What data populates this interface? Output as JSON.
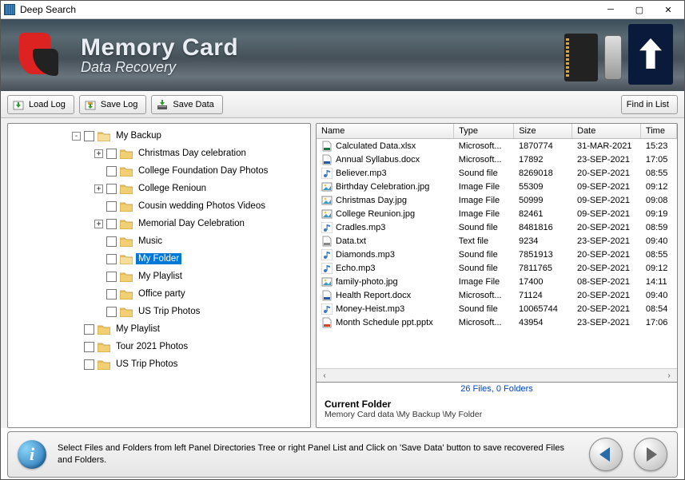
{
  "window": {
    "title": "Deep Search"
  },
  "banner": {
    "title": "Memory Card",
    "subtitle": "Data Recovery"
  },
  "toolbar": {
    "load_log": "Load Log",
    "save_log": "Save Log",
    "save_data": "Save Data",
    "find_in_list": "Find in List"
  },
  "tree": {
    "root_label": "My Backup",
    "selected": "My Folder",
    "items": [
      {
        "label": "Christmas Day celebration",
        "expandable": true
      },
      {
        "label": "College Foundation Day Photos",
        "expandable": false
      },
      {
        "label": "College Renioun",
        "expandable": true
      },
      {
        "label": "Cousin wedding Photos Videos",
        "expandable": false
      },
      {
        "label": "Memorial Day Celebration",
        "expandable": true
      },
      {
        "label": "Music",
        "expandable": false
      },
      {
        "label": "My Folder",
        "expandable": false,
        "selected": true
      },
      {
        "label": "My Playlist",
        "expandable": false
      },
      {
        "label": "Office party",
        "expandable": false
      },
      {
        "label": "US Trip Photos",
        "expandable": false
      }
    ],
    "siblings": [
      {
        "label": "My Playlist"
      },
      {
        "label": "Tour 2021 Photos"
      },
      {
        "label": "US Trip Photos"
      }
    ]
  },
  "file_columns": {
    "name": "Name",
    "type": "Type",
    "size": "Size",
    "date": "Date",
    "time": "Time"
  },
  "files": [
    {
      "name": "Calculated Data.xlsx",
      "type": "Microsoft...",
      "size": "1870774",
      "date": "31-MAR-2021",
      "time": "15:23",
      "icon": "xlsx"
    },
    {
      "name": "Annual Syllabus.docx",
      "type": "Microsoft...",
      "size": "17892",
      "date": "23-SEP-2021",
      "time": "17:05",
      "icon": "docx"
    },
    {
      "name": "Believer.mp3",
      "type": "Sound file",
      "size": "8269018",
      "date": "20-SEP-2021",
      "time": "08:55",
      "icon": "snd"
    },
    {
      "name": "Birthday Celebration.jpg",
      "type": "Image File",
      "size": "55309",
      "date": "09-SEP-2021",
      "time": "09:12",
      "icon": "img"
    },
    {
      "name": "Christmas Day.jpg",
      "type": "Image File",
      "size": "50999",
      "date": "09-SEP-2021",
      "time": "09:08",
      "icon": "img"
    },
    {
      "name": "College Reunion.jpg",
      "type": "Image File",
      "size": "82461",
      "date": "09-SEP-2021",
      "time": "09:19",
      "icon": "img"
    },
    {
      "name": "Cradles.mp3",
      "type": "Sound file",
      "size": "8481816",
      "date": "20-SEP-2021",
      "time": "08:59",
      "icon": "snd"
    },
    {
      "name": "Data.txt",
      "type": "Text file",
      "size": "9234",
      "date": "23-SEP-2021",
      "time": "09:40",
      "icon": "txt"
    },
    {
      "name": "Diamonds.mp3",
      "type": "Sound file",
      "size": "7851913",
      "date": "20-SEP-2021",
      "time": "08:55",
      "icon": "snd"
    },
    {
      "name": "Echo.mp3",
      "type": "Sound file",
      "size": "7811765",
      "date": "20-SEP-2021",
      "time": "09:12",
      "icon": "snd"
    },
    {
      "name": "family-photo.jpg",
      "type": "Image File",
      "size": "17400",
      "date": "08-SEP-2021",
      "time": "14:11",
      "icon": "img"
    },
    {
      "name": "Health Report.docx",
      "type": "Microsoft...",
      "size": "71124",
      "date": "20-SEP-2021",
      "time": "09:40",
      "icon": "docx"
    },
    {
      "name": "Money-Heist.mp3",
      "type": "Sound file",
      "size": "10065744",
      "date": "20-SEP-2021",
      "time": "08:54",
      "icon": "snd"
    },
    {
      "name": "Month Schedule ppt.pptx",
      "type": "Microsoft...",
      "size": "43954",
      "date": "23-SEP-2021",
      "time": "17:06",
      "icon": "pptx"
    }
  ],
  "status": {
    "count_text": "26 Files, 0 Folders",
    "current_folder_label": "Current Folder",
    "path": "Memory Card data \\My Backup \\My Folder"
  },
  "footer": {
    "message": "Select Files and Folders from left Panel Directories Tree or right Panel List and Click on 'Save Data' button to save recovered Files and Folders."
  }
}
